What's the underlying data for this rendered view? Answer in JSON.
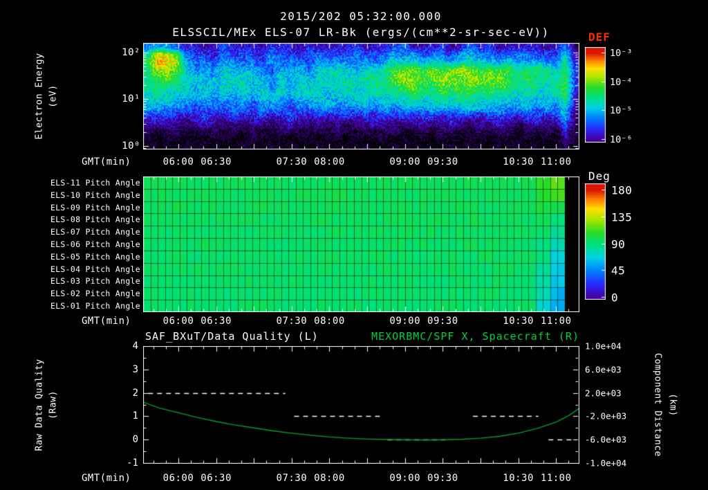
{
  "header": {
    "datetime": "2015/202 05:32:00.000",
    "plot_title": "ELSSCIL/MEx ELS-07 LR-Bk  (ergs/(cm**2-sr-sec-eV))"
  },
  "colors": {
    "background": "#000000",
    "text_white": "#ffffff",
    "accent_red": "#ff2d00",
    "accent_green": "#00d23c",
    "curve_green": "#00a32e",
    "no_data_color": "#000000",
    "rainbow_stops": [
      [
        0.0,
        "#4600a0"
      ],
      [
        0.12,
        "#2828ff"
      ],
      [
        0.25,
        "#0082ff"
      ],
      [
        0.37,
        "#00d2e6"
      ],
      [
        0.5,
        "#00e178"
      ],
      [
        0.6,
        "#28dc28"
      ],
      [
        0.72,
        "#aae600"
      ],
      [
        0.82,
        "#ffe100"
      ],
      [
        0.91,
        "#ff8200"
      ],
      [
        1.0,
        "#dc1400"
      ]
    ]
  },
  "chart_data": [
    {
      "type": "heatmap",
      "name": "electron-energy-spectrogram",
      "title": "ELSSCIL/MEx ELS-07 LR-Bk",
      "units_label": "(ergs/(cm**2-sr-sec-eV))",
      "x_axis": {
        "label": "GMT(min)",
        "start": "05:32",
        "end": "11:18",
        "start_min": 332,
        "end_min": 678,
        "tick_labels": [
          "06:00",
          "06:30",
          "07:30",
          "08:00",
          "09:00",
          "09:30",
          "10:30",
          "11:00"
        ],
        "tick_minutes": [
          360,
          390,
          450,
          480,
          540,
          570,
          630,
          660
        ]
      },
      "y_axis": {
        "label_line1": "Electron Energy",
        "label_line2": "(eV)",
        "scale": "log",
        "tick_labels": [
          "10²",
          "10¹",
          "10⁰"
        ],
        "tick_log10": [
          2,
          1,
          0
        ],
        "range_log10": [
          -0.06,
          2.2
        ]
      },
      "color_axis": {
        "title": "DEF",
        "scale": "log",
        "tick_labels": [
          "10⁻³",
          "10⁻⁴",
          "10⁻⁵",
          "10⁻⁶"
        ],
        "tick_log10": [
          -3,
          -4,
          -5,
          -6
        ],
        "bar_range_log10": [
          -2.8,
          -6.1
        ]
      },
      "value_encoding": "each hex digit n maps to log10(DEF) = -6.8 + 0.25*n; rows run top(~160 eV) to bottom(1 eV), 46 time columns span 05:32 to 11:18",
      "rows_hex": [
        "67754434544435443534445344563445346453444434 62",
        "9dcb6554655546554565556556767566577665666555 83",
        "addc7665766657666576766767888788788877877766 94",
        "9ccb8676877765777688887889abbababcbabaa99a98 a5",
        "9aba8877888876878788888999bcbabcbbcbbba9a998 a5",
        "99998787888786878888898899abbaabbabbaba99989 a5",
        "8988878787878787888788889899a99a9aa9a9989889 a4",
        "88877676767677767787778878889889899888878787 94",
        "77666556566566656667666767677777778777677676 83",
        "55544454454454454454454545554554555455545545 72",
        "34332343232332343232323343233433432334323433 62",
        "21221122121211221121211212211212211212212121 41",
        "10110101100110101101101011010101101101101010 31",
        "01001010001001010010010100101000101001010100 20"
      ],
      "rows_hex_note": "strings are 46 hex digits; the single space before the last two digits is cosmetic padding removed at parse time"
    },
    {
      "type": "heatmap",
      "name": "pitch-angle-panels",
      "x_axis": {
        "label": "GMT(min)",
        "start_min": 332,
        "end_min": 678
      },
      "color_axis": {
        "title": "Deg",
        "tick_labels": [
          "180",
          "135",
          "90",
          "45",
          "0"
        ],
        "tick_values": [
          180,
          135,
          90,
          45,
          0
        ],
        "range": [
          0,
          180
        ]
      },
      "note": "mean pitch angle per time bin; null = no data (black)",
      "rows": [
        {
          "label": "ELS-11 Pitch Angle",
          "values_deg": [
            97,
            96,
            98,
            95,
            97,
            96,
            97,
            98,
            96,
            97,
            95,
            96,
            97,
            96,
            98,
            97,
            96,
            95,
            97,
            96,
            98,
            97,
            96,
            97,
            98,
            96,
            97,
            108,
            116,
            null
          ]
        },
        {
          "label": "ELS-10 Pitch Angle",
          "values_deg": [
            96,
            97,
            95,
            96,
            98,
            96,
            95,
            97,
            96,
            95,
            97,
            96,
            95,
            98,
            96,
            95,
            97,
            96,
            95,
            97,
            96,
            98,
            95,
            96,
            97,
            95,
            96,
            104,
            111,
            null
          ]
        },
        {
          "label": "ELS-09 Pitch Angle",
          "values_deg": [
            95,
            96,
            97,
            94,
            96,
            95,
            96,
            95,
            97,
            96,
            94,
            95,
            96,
            97,
            95,
            96,
            94,
            96,
            95,
            96,
            97,
            95,
            96,
            94,
            96,
            95,
            97,
            100,
            98,
            null
          ]
        },
        {
          "label": "ELS-08 Pitch Angle",
          "values_deg": [
            96,
            95,
            94,
            96,
            95,
            97,
            94,
            96,
            95,
            96,
            95,
            94,
            96,
            95,
            96,
            94,
            95,
            96,
            95,
            94,
            96,
            95,
            97,
            95,
            94,
            96,
            95,
            96,
            88,
            null
          ]
        },
        {
          "label": "ELS-07 Pitch Angle",
          "values_deg": [
            95,
            94,
            96,
            95,
            94,
            96,
            95,
            94,
            96,
            95,
            96,
            94,
            95,
            96,
            94,
            95,
            96,
            94,
            95,
            96,
            94,
            96,
            95,
            94,
            96,
            95,
            94,
            93,
            82,
            null
          ]
        },
        {
          "label": "ELS-06 Pitch Angle",
          "values_deg": [
            94,
            95,
            93,
            94,
            96,
            94,
            95,
            93,
            95,
            94,
            93,
            95,
            94,
            93,
            95,
            94,
            93,
            95,
            94,
            95,
            93,
            94,
            95,
            93,
            94,
            95,
            93,
            90,
            76,
            null
          ]
        },
        {
          "label": "ELS-05 Pitch Angle",
          "values_deg": [
            93,
            94,
            95,
            93,
            94,
            93,
            95,
            94,
            93,
            94,
            95,
            93,
            94,
            95,
            93,
            94,
            95,
            93,
            94,
            93,
            95,
            94,
            93,
            95,
            94,
            93,
            94,
            87,
            70,
            null
          ]
        },
        {
          "label": "ELS-04 Pitch Angle",
          "values_deg": [
            94,
            93,
            94,
            95,
            93,
            94,
            93,
            94,
            95,
            93,
            94,
            93,
            95,
            93,
            94,
            93,
            94,
            95,
            93,
            94,
            93,
            95,
            94,
            93,
            94,
            95,
            93,
            84,
            66,
            null
          ]
        },
        {
          "label": "ELS-03 Pitch Angle",
          "values_deg": [
            93,
            94,
            92,
            93,
            94,
            93,
            92,
            94,
            93,
            92,
            94,
            93,
            92,
            94,
            93,
            94,
            92,
            93,
            94,
            92,
            93,
            94,
            92,
            93,
            94,
            92,
            93,
            80,
            62,
            null
          ]
        },
        {
          "label": "ELS-02 Pitch Angle",
          "values_deg": [
            92,
            93,
            94,
            92,
            93,
            92,
            94,
            93,
            92,
            93,
            92,
            94,
            92,
            93,
            92,
            94,
            93,
            92,
            93,
            94,
            92,
            93,
            92,
            94,
            93,
            92,
            93,
            77,
            58,
            null
          ]
        },
        {
          "label": "ELS-01 Pitch Angle",
          "values_deg": [
            93,
            92,
            93,
            94,
            92,
            93,
            92,
            93,
            94,
            92,
            93,
            92,
            93,
            92,
            94,
            92,
            93,
            92,
            93,
            92,
            94,
            93,
            92,
            93,
            92,
            94,
            92,
            73,
            55,
            null
          ]
        }
      ]
    },
    {
      "type": "line",
      "name": "quality-and-spacecraft-distance",
      "title_left": "SAF_BXuT/Data Quality (L)",
      "title_right": "MEXORBMC/SPF X, Spacecraft (R)",
      "x_axis": {
        "label": "GMT(min)",
        "start_min": 332,
        "end_min": 678
      },
      "left_axis": {
        "label_line1": "Raw Data Quality",
        "label_line2": "(Raw)",
        "range": [
          -1,
          4
        ],
        "ticks": [
          4,
          3,
          2,
          1,
          0,
          -1
        ]
      },
      "right_axis": {
        "label_line1": "Component Distance",
        "label_line2": "(km)",
        "range": [
          -10000,
          10000
        ],
        "tick_labels": [
          "1.0e+04",
          "6.0e+03",
          "2.0e+03",
          "-2.0e+03",
          "-6.0e+03",
          "-1.0e+04"
        ],
        "tick_values": [
          10000,
          6000,
          2000,
          -2000,
          -6000,
          -10000
        ]
      },
      "series": [
        {
          "name": "SAF_BXuT/Data Quality",
          "axis": "left",
          "style": "dashed",
          "color": "#ffffff",
          "segments": [
            {
              "t_start_min": 336,
              "t_end_min": 445,
              "value": 2
            },
            {
              "t_start_min": 452,
              "t_end_min": 520,
              "value": 1
            },
            {
              "t_start_min": 526,
              "t_end_min": 572,
              "value": 0
            },
            {
              "t_start_min": 594,
              "t_end_min": 646,
              "value": 1
            },
            {
              "t_start_min": 654,
              "t_end_min": 676,
              "value": 0
            }
          ]
        },
        {
          "name": "MEXORBMC/SPF X Spacecraft",
          "axis": "right",
          "style": "solid",
          "color": "#00a32e",
          "points_min_km": [
            [
              332,
              400
            ],
            [
              345,
              -600
            ],
            [
              360,
              -1400
            ],
            [
              375,
              -2200
            ],
            [
              390,
              -2900
            ],
            [
              405,
              -3500
            ],
            [
              420,
              -4000
            ],
            [
              435,
              -4500
            ],
            [
              450,
              -4900
            ],
            [
              465,
              -5250
            ],
            [
              480,
              -5550
            ],
            [
              495,
              -5750
            ],
            [
              510,
              -5900
            ],
            [
              525,
              -5980
            ],
            [
              540,
              -6030
            ],
            [
              555,
              -6060
            ],
            [
              570,
              -6040
            ],
            [
              585,
              -5950
            ],
            [
              600,
              -5750
            ],
            [
              615,
              -5450
            ],
            [
              630,
              -4900
            ],
            [
              645,
              -4100
            ],
            [
              660,
              -3000
            ],
            [
              670,
              -1900
            ],
            [
              678,
              -700
            ]
          ]
        }
      ]
    }
  ]
}
